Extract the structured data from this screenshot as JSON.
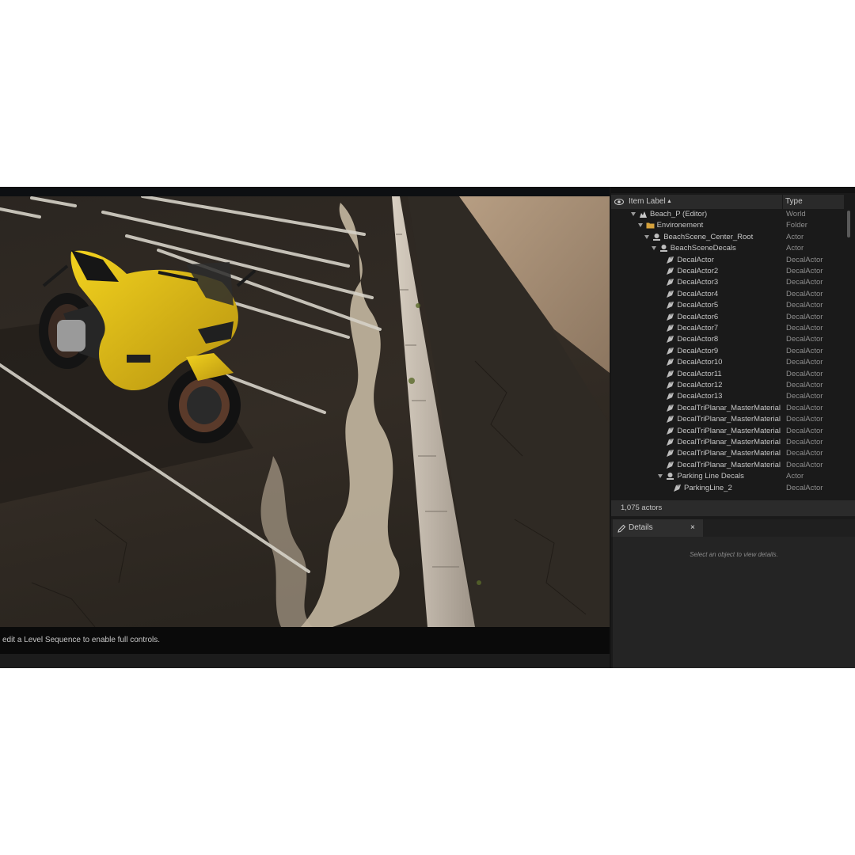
{
  "viewport": {
    "message": "edit a Level Sequence to enable full controls."
  },
  "outliner": {
    "columns": {
      "label": "Item Label",
      "type": "Type"
    },
    "rows": [
      {
        "label": "Beach_P (Editor)",
        "type": "World",
        "depth": 0,
        "icon": "world-icon",
        "expanded": true
      },
      {
        "label": "Environement",
        "type": "Folder",
        "depth": 1,
        "icon": "folder-icon",
        "expanded": true
      },
      {
        "label": "BeachScene_Center_Root",
        "type": "Actor",
        "depth": 2,
        "icon": "actor-icon",
        "expanded": true
      },
      {
        "label": "BeachSceneDecals",
        "type": "Actor",
        "depth": 3,
        "icon": "actor-icon",
        "expanded": true
      },
      {
        "label": "DecalActor",
        "type": "DecalActor",
        "depth": 4,
        "icon": "decal-icon"
      },
      {
        "label": "DecalActor2",
        "type": "DecalActor",
        "depth": 4,
        "icon": "decal-icon"
      },
      {
        "label": "DecalActor3",
        "type": "DecalActor",
        "depth": 4,
        "icon": "decal-icon"
      },
      {
        "label": "DecalActor4",
        "type": "DecalActor",
        "depth": 4,
        "icon": "decal-icon"
      },
      {
        "label": "DecalActor5",
        "type": "DecalActor",
        "depth": 4,
        "icon": "decal-icon"
      },
      {
        "label": "DecalActor6",
        "type": "DecalActor",
        "depth": 4,
        "icon": "decal-icon"
      },
      {
        "label": "DecalActor7",
        "type": "DecalActor",
        "depth": 4,
        "icon": "decal-icon"
      },
      {
        "label": "DecalActor8",
        "type": "DecalActor",
        "depth": 4,
        "icon": "decal-icon"
      },
      {
        "label": "DecalActor9",
        "type": "DecalActor",
        "depth": 4,
        "icon": "decal-icon"
      },
      {
        "label": "DecalActor10",
        "type": "DecalActor",
        "depth": 4,
        "icon": "decal-icon"
      },
      {
        "label": "DecalActor11",
        "type": "DecalActor",
        "depth": 4,
        "icon": "decal-icon"
      },
      {
        "label": "DecalActor12",
        "type": "DecalActor",
        "depth": 4,
        "icon": "decal-icon"
      },
      {
        "label": "DecalActor13",
        "type": "DecalActor",
        "depth": 4,
        "icon": "decal-icon"
      },
      {
        "label": "DecalTriPlanar_MasterMaterial",
        "type": "DecalActor",
        "depth": 4,
        "icon": "decal-icon"
      },
      {
        "label": "DecalTriPlanar_MasterMaterial",
        "type": "DecalActor",
        "depth": 4,
        "icon": "decal-icon"
      },
      {
        "label": "DecalTriPlanar_MasterMaterial",
        "type": "DecalActor",
        "depth": 4,
        "icon": "decal-icon"
      },
      {
        "label": "DecalTriPlanar_MasterMaterial",
        "type": "DecalActor",
        "depth": 4,
        "icon": "decal-icon"
      },
      {
        "label": "DecalTriPlanar_MasterMaterial",
        "type": "DecalActor",
        "depth": 4,
        "icon": "decal-icon"
      },
      {
        "label": "DecalTriPlanar_MasterMaterial",
        "type": "DecalActor",
        "depth": 4,
        "icon": "decal-icon"
      },
      {
        "label": "Parking Line Decals",
        "type": "Actor",
        "depth": 4,
        "icon": "actor-icon",
        "expanded": true
      },
      {
        "label": "ParkingLine_2",
        "type": "DecalActor",
        "depth": 5,
        "icon": "decal-icon"
      }
    ],
    "count": "1,075 actors"
  },
  "details": {
    "tab_label": "Details",
    "close_label": "×",
    "hint": "Select an object to view details."
  },
  "colors": {
    "accent_yellow": "#e8c21a",
    "panel_bg": "#1a1a1a",
    "header_bg": "#2a2a2a"
  }
}
